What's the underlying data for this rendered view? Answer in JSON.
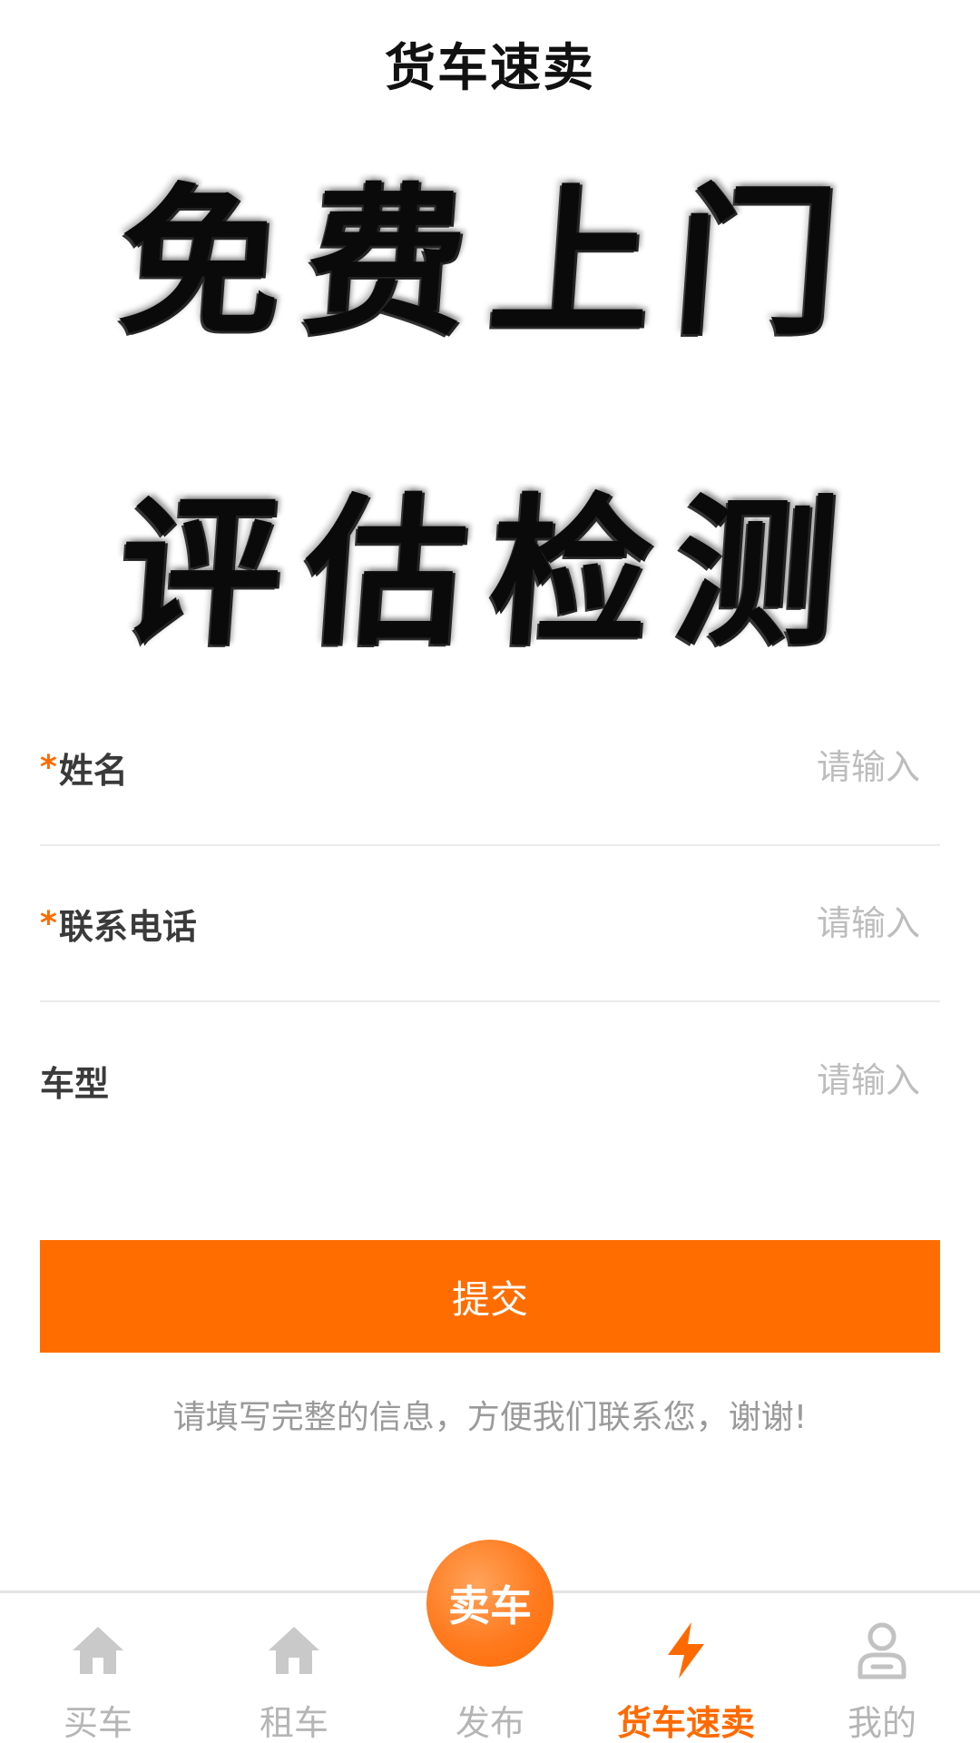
{
  "header": {
    "title": "货车速卖"
  },
  "hero": {
    "line1": "免费上门",
    "line2": "评估检测"
  },
  "form": {
    "required_mark": "*",
    "fields": [
      {
        "label": "姓名",
        "required": true,
        "placeholder": "请输入",
        "value": ""
      },
      {
        "label": "联系电话",
        "required": true,
        "placeholder": "请输入",
        "value": ""
      },
      {
        "label": "车型",
        "required": false,
        "placeholder": "请输入",
        "value": ""
      }
    ]
  },
  "submit": {
    "label": "提交"
  },
  "hint": "请填写完整的信息，方便我们联系您，谢谢!",
  "tabbar": {
    "publish_circle_label": "卖车",
    "tabs": [
      {
        "label": "买车",
        "icon": "home-icon",
        "active": false
      },
      {
        "label": "租车",
        "icon": "home-icon",
        "active": false
      },
      {
        "label": "发布",
        "icon": "publish-icon",
        "active": false
      },
      {
        "label": "货车速卖",
        "icon": "lightning-icon",
        "active": true
      },
      {
        "label": "我的",
        "icon": "user-icon",
        "active": false
      }
    ]
  },
  "colors": {
    "accent": "#ff6d00",
    "inactive": "#b5b5b5",
    "required": "#ff6a00"
  }
}
